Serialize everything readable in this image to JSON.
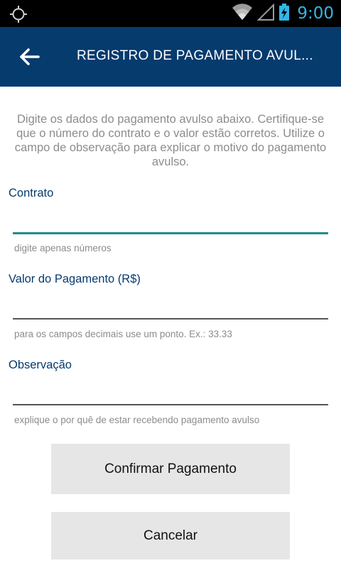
{
  "status_bar": {
    "time": "9:00",
    "icons": [
      "gps-icon",
      "wifi-icon",
      "signal-icon",
      "battery-charging-icon"
    ],
    "accent_color": "#33b5e5"
  },
  "app_bar": {
    "title": "REGISTRO DE PAGAMENTO AVUL...",
    "back_icon": "arrow-left-icon",
    "background": "#063b6e"
  },
  "intro_text": "Digite os dados do pagamento avulso abaixo. Certifique-se que o número do contrato e o valor estão corretos. Utilize o campo de observação para explicar o motivo do pagamento avulso.",
  "form": {
    "contrato": {
      "label": "Contrato",
      "value": "",
      "hint": "digite apenas números",
      "focused": true
    },
    "valor": {
      "label": "Valor do Pagamento (R$)",
      "value": "",
      "hint": "para os campos decimais use um ponto. Ex.: 33.33"
    },
    "observacao": {
      "label": "Observação",
      "value": "",
      "hint": "explique o por quê  de estar recebendo pagamento avulso"
    }
  },
  "buttons": {
    "confirm_label": "Confirmar Pagamento",
    "cancel_label": "Cancelar"
  },
  "colors": {
    "label": "#063b6e",
    "focus_underline": "#1e8c8c",
    "hint": "#8c8c8c",
    "button_bg": "#e6e6e6"
  }
}
